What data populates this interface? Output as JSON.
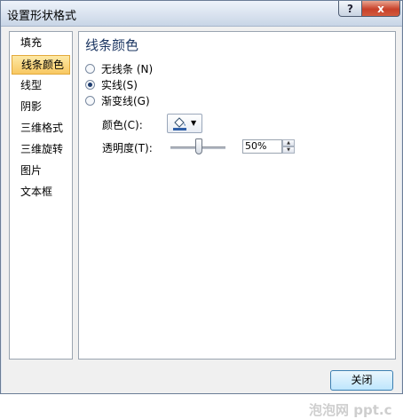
{
  "window": {
    "title": "设置形状格式",
    "help_glyph": "?",
    "close_glyph": "x"
  },
  "nav": {
    "items": [
      {
        "label": "填充"
      },
      {
        "label": "线条颜色"
      },
      {
        "label": "线型"
      },
      {
        "label": "阴影"
      },
      {
        "label": "三维格式"
      },
      {
        "label": "三维旋转"
      },
      {
        "label": "图片"
      },
      {
        "label": "文本框"
      }
    ],
    "selected": "线条颜色"
  },
  "panel": {
    "title": "线条颜色",
    "options": [
      {
        "label": "无线条 (N)",
        "checked": false
      },
      {
        "label": "实线(S)",
        "checked": true
      },
      {
        "label": "渐变线(G)",
        "checked": false
      }
    ],
    "color_label": "颜色(C):",
    "color_icon": "paint-bucket-icon",
    "dropdown_glyph": "▼",
    "transparency_label": "透明度(T):",
    "transparency_value": "50%",
    "spin_up_glyph": "▲",
    "spin_down_glyph": "▼"
  },
  "footer": {
    "close_label": "关闭"
  },
  "watermark": "泡泡网 ppt.c",
  "colors": {
    "selected_item_bg": "#f8c862",
    "panel_title": "#1d3763",
    "close_button_red": "#c8412a"
  }
}
